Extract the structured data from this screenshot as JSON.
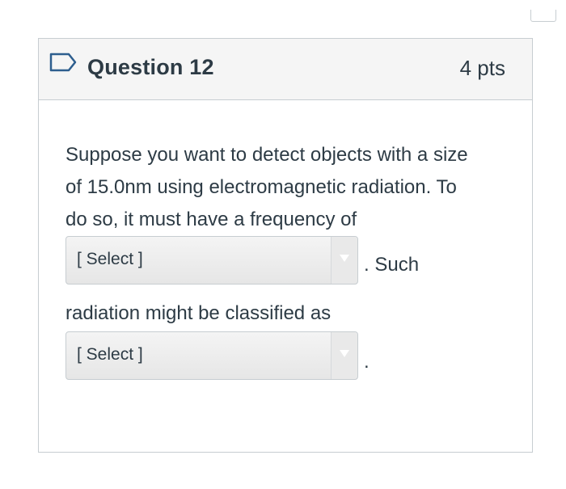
{
  "question": {
    "title": "Question 12",
    "points": "4 pts",
    "flag_icon": "bookmark-flag-icon",
    "body_lines": [
      "Suppose you want to detect objects with a size",
      "of 15.0nm using electromagnetic radiation. To",
      "do so, it must have a frequency of"
    ],
    "after_select_1": ". Such",
    "line_4": "radiation might be classified as",
    "after_select_2": ".",
    "select_1": {
      "label": "[ Select ]"
    },
    "select_2": {
      "label": "[ Select ]"
    }
  },
  "colors": {
    "text": "#2d3b45",
    "border": "#c7cdd1",
    "header_bg": "#f5f5f5",
    "flag": "#2d5e8e"
  }
}
